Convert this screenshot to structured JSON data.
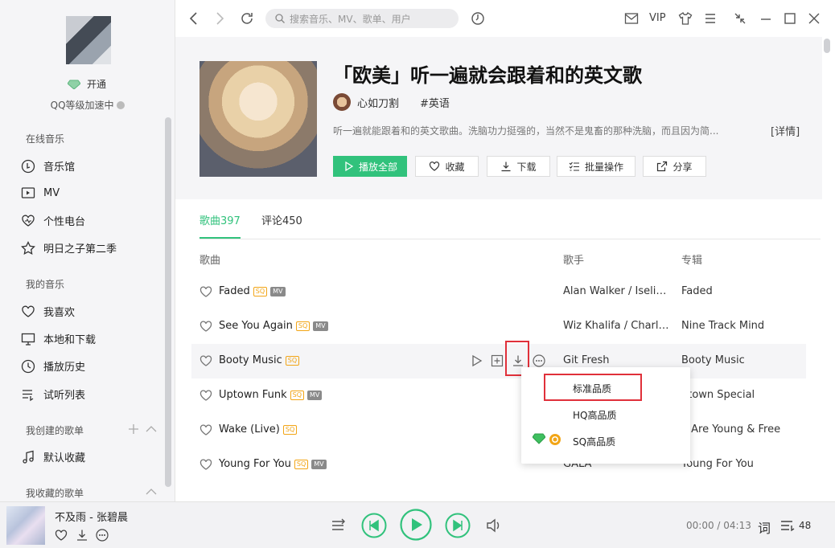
{
  "sidebar": {
    "open_vip": "开通",
    "level_text": "QQ等级加速中",
    "online_music": "在线音乐",
    "online_items": [
      "音乐馆",
      "MV",
      "个性电台",
      "明日之子第二季"
    ],
    "my_music": "我的音乐",
    "my_items": [
      "我喜欢",
      "本地和下载",
      "播放历史",
      "试听列表"
    ],
    "created_lists": "我创建的歌单",
    "created_items": [
      "默认收藏"
    ],
    "collected_lists": "我收藏的歌单"
  },
  "topbar": {
    "search_placeholder": "搜索音乐、MV、歌单、用户",
    "vip": "VIP"
  },
  "playlist": {
    "title": "「欧美」听一遍就会跟着和的英文歌",
    "creator": "心如刀割",
    "tag": "#英语",
    "description": "听一遍就能跟着和的英文歌曲。洗脑功力挺强的，当然不是鬼畜的那种洗脑，而且因为简...",
    "detail_link": "[详情]",
    "actions": [
      "播放全部",
      "收藏",
      "下载",
      "批量操作",
      "分享"
    ]
  },
  "tabs": [
    "歌曲397",
    "评论450"
  ],
  "columns": [
    "歌曲",
    "歌手",
    "专辑"
  ],
  "songs": [
    {
      "title": "Faded",
      "badges": [
        "SQ",
        "MV"
      ],
      "artist": "Alan Walker / Iselin Solheim",
      "album": "Faded"
    },
    {
      "title": "See You Again",
      "badges": [
        "SQ",
        "MV"
      ],
      "artist": "Wiz Khalifa / Charlie Puth",
      "album": "Nine Track Mind"
    },
    {
      "title": "Booty Music",
      "badges": [
        "SQ"
      ],
      "artist": "Git Fresh",
      "album": "Booty Music"
    },
    {
      "title": "Uptown Funk",
      "badges": [
        "SQ",
        "MV"
      ],
      "artist": "",
      "album": "ptown Special"
    },
    {
      "title": "Wake (Live)",
      "badges": [
        "SQ"
      ],
      "artist": "",
      "album": "e Are Young & Free"
    },
    {
      "title": "Young For You",
      "badges": [
        "SQ",
        "MV"
      ],
      "artist": "GALA",
      "album": "Young For You"
    }
  ],
  "download_menu": {
    "items": [
      "标准品质",
      "HQ高品质",
      "SQ高品质"
    ]
  },
  "player": {
    "now_playing": "不及雨 - 张碧晨",
    "time": "00:00 / 04:13",
    "lyrics": "词",
    "playlist_count": "48"
  },
  "colors": {
    "accent": "#31c27c",
    "highlight": "#e0303a"
  }
}
